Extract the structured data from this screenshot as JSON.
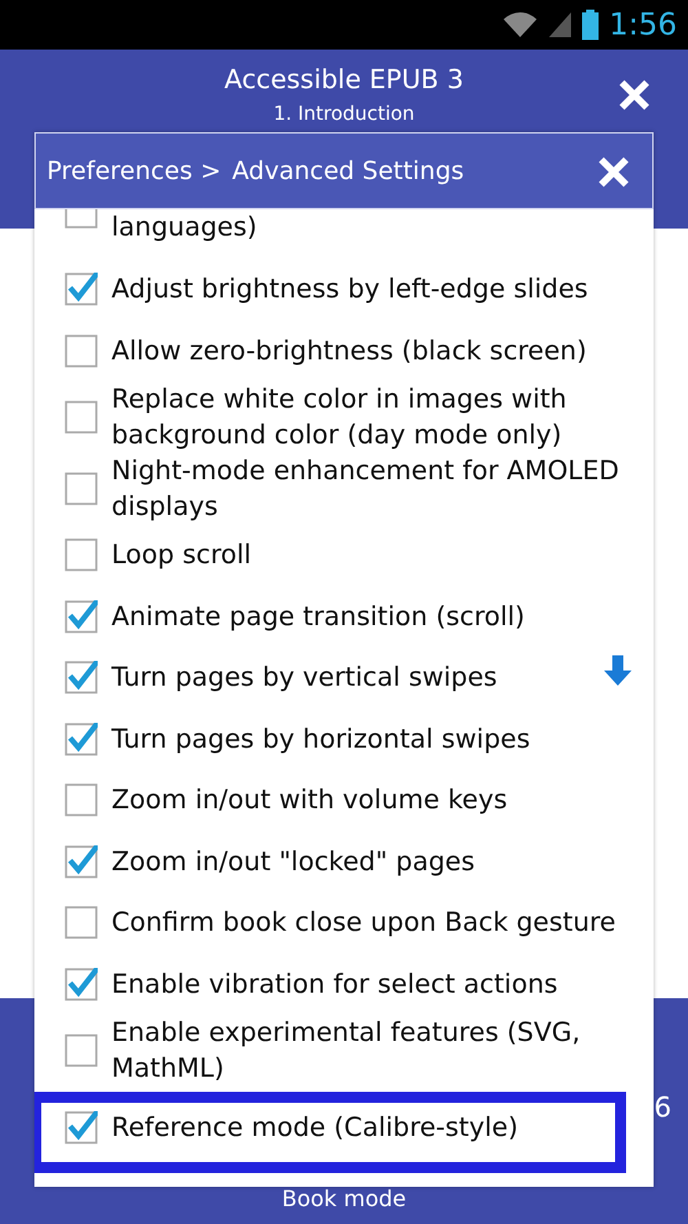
{
  "status_bar": {
    "time": "1:56"
  },
  "header": {
    "title": "Accessible EPUB 3",
    "subtitle": "1. Introduction"
  },
  "dialog": {
    "breadcrumb": "Preferences >",
    "title": "Advanced Settings",
    "items": [
      {
        "label": "languages)",
        "checked": false,
        "highlighted": false
      },
      {
        "label": "Adjust brightness by left-edge slides",
        "checked": true,
        "highlighted": false
      },
      {
        "label": "Allow zero-brightness (black screen)",
        "checked": false,
        "highlighted": false
      },
      {
        "label": "Replace white color in images with background color (day mode only)",
        "checked": false,
        "highlighted": false
      },
      {
        "label": "Night-mode enhancement for AMOLED displays",
        "checked": false,
        "highlighted": false
      },
      {
        "label": "Loop scroll",
        "checked": false,
        "highlighted": false
      },
      {
        "label": "Animate page transition (scroll)",
        "checked": true,
        "highlighted": false
      },
      {
        "label": "Turn pages by vertical swipes",
        "checked": true,
        "highlighted": false,
        "scroll_hint": true
      },
      {
        "label": "Turn pages by horizontal swipes",
        "checked": true,
        "highlighted": false
      },
      {
        "label": "Zoom in/out with volume keys",
        "checked": false,
        "highlighted": false
      },
      {
        "label": "Zoom in/out \"locked\" pages",
        "checked": true,
        "highlighted": false
      },
      {
        "label": "Confirm book close upon Back gesture",
        "checked": false,
        "highlighted": false
      },
      {
        "label": "Enable vibration for select actions",
        "checked": true,
        "highlighted": false
      },
      {
        "label": "Enable experimental features (SVG, MathML)",
        "checked": false,
        "highlighted": false
      },
      {
        "label": "Reference mode (Calibre-style)",
        "checked": true,
        "highlighted": true
      }
    ]
  },
  "bottom_bar": {
    "mode": "Book mode",
    "page_fragment": "6"
  }
}
